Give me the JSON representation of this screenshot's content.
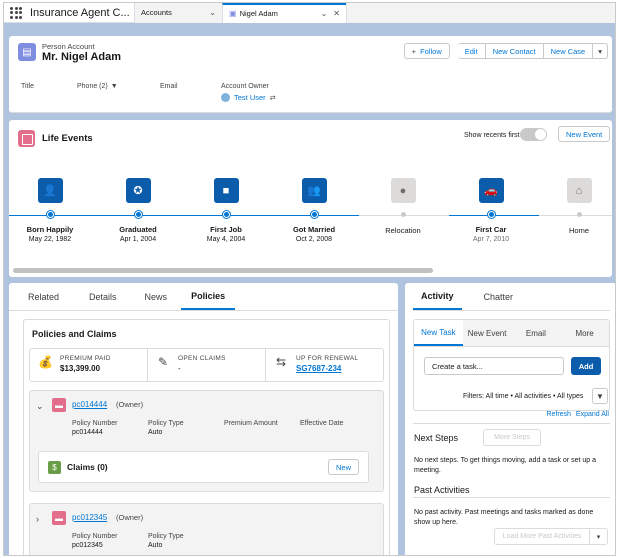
{
  "nav": {
    "app_name": "Insurance Agent C...",
    "tabs": [
      {
        "label": "Accounts"
      },
      {
        "label": "Nigel Adam"
      }
    ]
  },
  "header": {
    "type": "Person Account",
    "name": "Mr. Nigel Adam",
    "buttons": {
      "follow": "Follow",
      "edit": "Edit",
      "new_contact": "New Contact",
      "new_case": "New Case"
    },
    "fields": {
      "title": "Title",
      "phone": "Phone (2)",
      "email": "Email",
      "owner_label": "Account Owner",
      "owner_value": "Test User"
    }
  },
  "life_events": {
    "title": "Life Events",
    "toggle_label": "Show recents first",
    "toggle_on": false,
    "new_event": "New Event",
    "events": [
      {
        "name": "Born Happily",
        "date": "May 22, 1982",
        "icon": "person-icon",
        "active": true
      },
      {
        "name": "Graduated",
        "date": "Apr 1, 2004",
        "icon": "graduation-icon",
        "active": true
      },
      {
        "name": "First Job",
        "date": "May 4, 2004",
        "icon": "briefcase-icon",
        "active": true
      },
      {
        "name": "Got Married",
        "date": "Oct 2, 2008",
        "icon": "couple-icon",
        "active": true
      },
      {
        "name": "Relocation",
        "date": "",
        "icon": "location-pin-icon",
        "active": false
      },
      {
        "name": "First Car",
        "date": "Apr 7, 2010",
        "icon": "car-icon",
        "active": true
      },
      {
        "name": "Home",
        "date": "",
        "icon": "home-icon",
        "active": false
      }
    ]
  },
  "left_tabs": [
    "Related",
    "Details",
    "News",
    "Policies"
  ],
  "policies": {
    "title": "Policies and Claims",
    "stats": [
      {
        "label": "PREMIUM PAID",
        "value": "$13,399.00",
        "icon": "money-bag-icon"
      },
      {
        "label": "OPEN CLAIMS",
        "value": "-",
        "icon": "document-icon"
      },
      {
        "label": "UP FOR RENEWAL",
        "value": "SG7687-234",
        "icon": "renewal-icon"
      }
    ],
    "columns": [
      "Policy Number",
      "Policy Type",
      "Premium Amount",
      "Effective Date"
    ],
    "items": [
      {
        "number": "pc014444",
        "role": "(Owner)",
        "policy_number": "pc014444",
        "policy_type": "Auto",
        "claims_title": "Claims (0)",
        "claims_new": "New"
      },
      {
        "number": "pc012345",
        "role": "(Owner)",
        "policy_number": "pc012345",
        "policy_type": "Auto"
      }
    ]
  },
  "activity": {
    "tabs": [
      "Activity",
      "Chatter"
    ],
    "sub_tabs": [
      "New Task",
      "New Event",
      "Email",
      "More"
    ],
    "task_value": "Create a task...",
    "add": "Add",
    "filters": "Filters: All time • All activities • All types",
    "refresh": "Refresh",
    "expand_all": "Expand All",
    "next_steps_title": "Next Steps",
    "more_steps": "More Steps",
    "next_steps_text": "No next steps. To get things moving, add a task or set up a meeting.",
    "past_title": "Past Activities",
    "past_text": "No past activity. Past meetings and tasks marked as done show up here.",
    "load_more": "Load More Past Activities"
  }
}
